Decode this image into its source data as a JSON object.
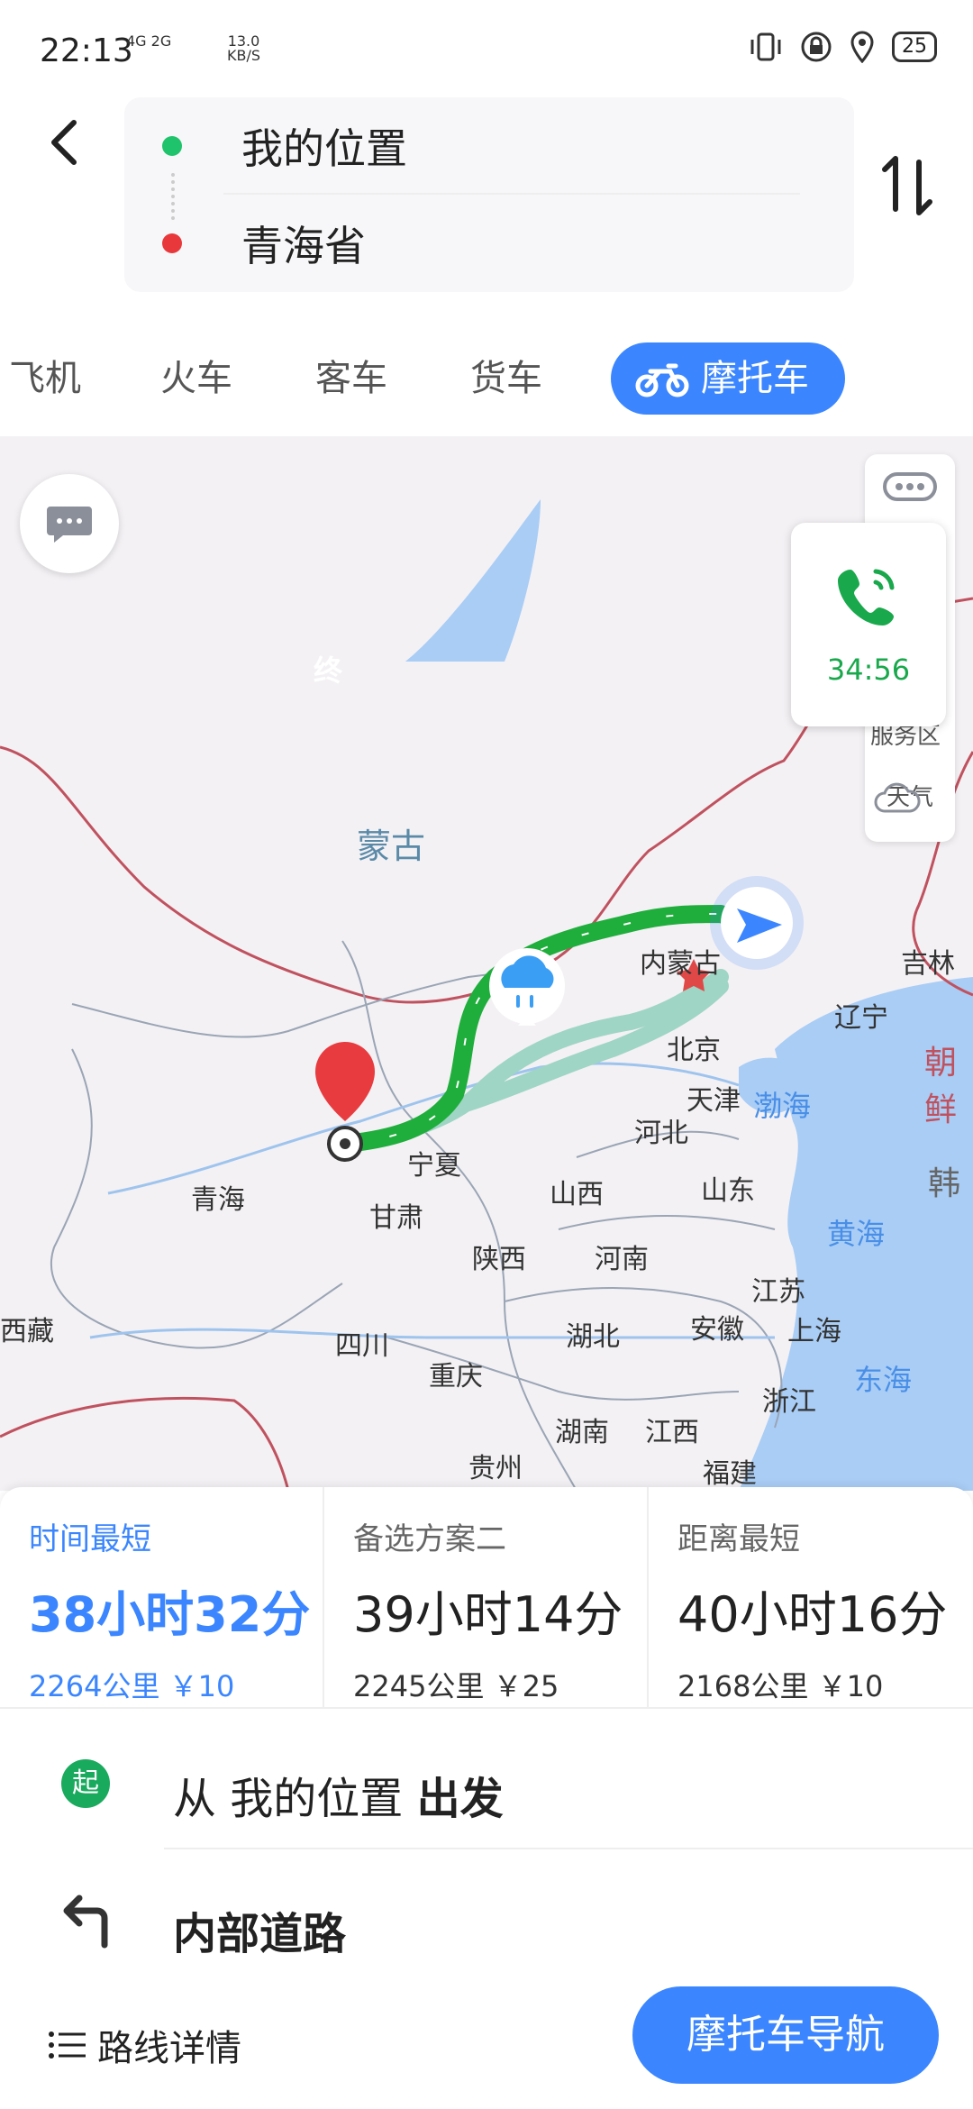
{
  "status_bar": {
    "time": "22:13",
    "network": "4G 2G",
    "speed_value": "13.0",
    "speed_unit": "KB/S",
    "battery": "25"
  },
  "header": {
    "origin": "我的位置",
    "destination": "青海省"
  },
  "tabs": [
    "飞机",
    "火车",
    "客车",
    "货车",
    "摩托车"
  ],
  "active_tab": "摩托车",
  "map": {
    "labels": [
      "蒙古",
      "内蒙古",
      "吉林",
      "辽宁",
      "朝鲜",
      "北京",
      "天津",
      "渤海",
      "河北",
      "宁夏",
      "青海",
      "甘肃",
      "山西",
      "山东",
      "韩",
      "黄海",
      "陕西",
      "河南",
      "江苏",
      "上海",
      "西藏",
      "四川",
      "湖北",
      "安徽",
      "重庆",
      "浙江",
      "东海",
      "湖南",
      "江西",
      "贵州",
      "福建"
    ],
    "end_marker": "终",
    "call_time": "34:56",
    "service_area": "服务区",
    "weather": "天气"
  },
  "routes": [
    {
      "label": "时间最短",
      "duration": "38小时32分",
      "distance": "2264公里",
      "cost": "￥10",
      "selected": true
    },
    {
      "label": "备选方案二",
      "duration": "39小时14分",
      "distance": "2245公里",
      "cost": "￥25",
      "selected": false
    },
    {
      "label": "距离最短",
      "duration": "40小时16分",
      "distance": "2168公里",
      "cost": "￥10",
      "selected": false
    }
  ],
  "steps": {
    "start_badge": "起",
    "start_prefix": "从",
    "start_place": "我的位置",
    "start_suffix": "出发",
    "road": "内部道路"
  },
  "footer": {
    "details_label": "路线详情",
    "nav_button": "摩托车导航"
  },
  "colors": {
    "accent": "#3b86ff",
    "route_green": "#1fae3c",
    "origin_dot": "#1fc36b",
    "dest_dot": "#e8383b"
  }
}
